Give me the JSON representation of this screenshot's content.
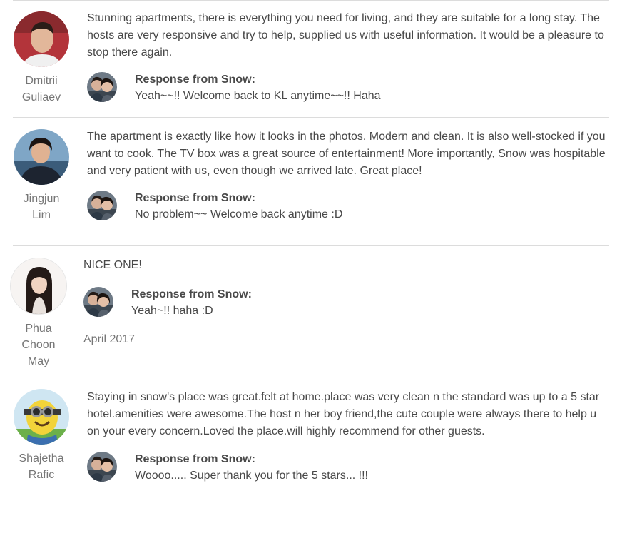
{
  "reviews": [
    {
      "reviewer": "Dmitrii Guliaev",
      "name_line1": "Dmitrii",
      "name_line2": "Guliaev",
      "name_line3": "",
      "avatar_icon": "reviewer-photo-man",
      "text": "Stunning apartments, there is everything you need for living, and they are suitable for a long stay. The hosts are very responsive and try to help, supplied us with useful information. It would be a pleasure to stop there again.",
      "response_title": "Response from Snow:",
      "response_text": "Yeah~~!! Welcome back to KL anytime~~!! Haha",
      "date": ""
    },
    {
      "reviewer": "Jingjun Lim",
      "name_line1": "Jingjun",
      "name_line2": "Lim",
      "name_line3": "",
      "avatar_icon": "reviewer-photo-woman",
      "text": "The apartment is exactly like how it looks in the photos. Modern and clean. It is also well-stocked if you want to cook. The TV box was a great source of entertainment! More importantly, Snow was hospitable and very patient with us, even though we arrived late. Great place!",
      "response_title": "Response from Snow:",
      "response_text": "No problem~~ Welcome back anytime :D",
      "date": ""
    },
    {
      "reviewer": "Phua Choon May",
      "name_line1": "Phua",
      "name_line2": "Choon",
      "name_line3": "May",
      "avatar_icon": "reviewer-photo-woman-long-hair",
      "text": "NICE ONE!",
      "response_title": "Response from Snow:",
      "response_text": "Yeah~!! haha :D",
      "date": "April 2017"
    },
    {
      "reviewer": "Shajetha Rafic",
      "name_line1": "Shajetha",
      "name_line2": "Rafic",
      "name_line3": "",
      "avatar_icon": "reviewer-photo-cartoon-minion",
      "text": "Staying in snow's place was great.felt at home.place was very clean n the standard was up to a 5 star hotel.amenities were awesome.The host n her boy friend,the cute couple were always there to help u on your every concern.Loved the place.will highly recommend for other guests.",
      "response_title": "Response from Snow:",
      "response_text": "Woooo..... Super thank you for the 5 stars... !!!",
      "date": ""
    }
  ],
  "host": {
    "name": "Snow",
    "avatar_icon": "host-couple-photo"
  }
}
